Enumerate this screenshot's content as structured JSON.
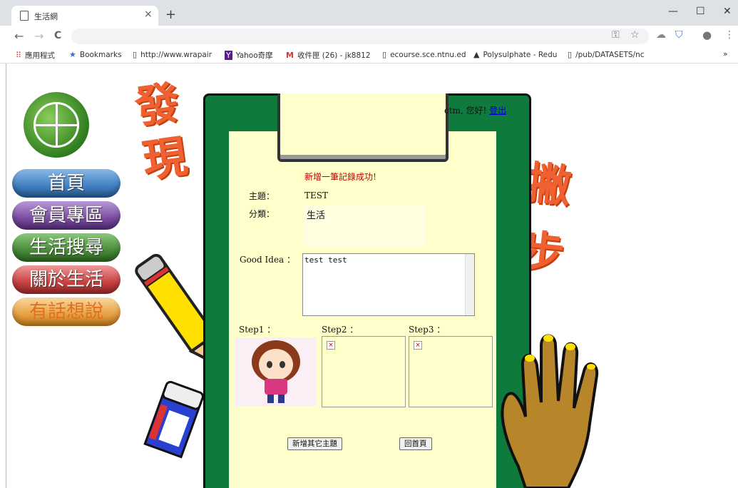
{
  "browser": {
    "tab_title": "生活網",
    "close_tab": "×",
    "new_tab": "+",
    "win_min": "—",
    "win_max": "☐",
    "win_close": "✕",
    "nav_back": "←",
    "nav_forward": "→",
    "nav_reload": "C",
    "menu": "⋮"
  },
  "bookmarks": [
    {
      "label": "應用程式",
      "icon": "apps-grid-icon"
    },
    {
      "label": "Bookmarks",
      "icon": "star-icon"
    },
    {
      "label": "http://www.wrapair",
      "icon": "page-icon"
    },
    {
      "label": "Yahoo奇摩",
      "icon": "yahoo-icon"
    },
    {
      "label": "收件匣 (26) - jk8812",
      "icon": "gmail-icon"
    },
    {
      "label": "ecourse.sce.ntnu.ed",
      "icon": "page-icon"
    },
    {
      "label": "Polysulphate - Redu",
      "icon": "triangle-logo-icon"
    },
    {
      "label": "/pub/DATASETS/nc",
      "icon": "page-icon"
    }
  ],
  "bookmarks_more": "»",
  "menu_items": [
    "首頁",
    "會員專區",
    "生活搜尋",
    "關於生活",
    "有話想說"
  ],
  "menu_colors": [
    "#3f7fc0",
    "#7a4ca0",
    "#4a8a3a",
    "#c84040",
    "#e8a040"
  ],
  "deco": {
    "left": "發\n現",
    "right": "撇\n步"
  },
  "greeting": {
    "user": "ctm, 您好!",
    "logout": "登出"
  },
  "form": {
    "success_msg": "新增一筆記錄成功!",
    "topic_label": "主題：",
    "topic_value": "TEST",
    "category_label": "分類：",
    "category_value": "生活",
    "idea_label": "Good Idea ：",
    "idea_value": "test test",
    "step1_label": "Step1 ：",
    "step2_label": "Step2 ：",
    "step3_label": "Step3 ：",
    "broken_image": "×"
  },
  "buttons": {
    "add_other": "新增其它主題",
    "back_home": "回首頁"
  },
  "colors": {
    "board": "#0e7a3c",
    "paper": "#ffffcc",
    "success": "#c00000",
    "deco": "#f06030"
  }
}
